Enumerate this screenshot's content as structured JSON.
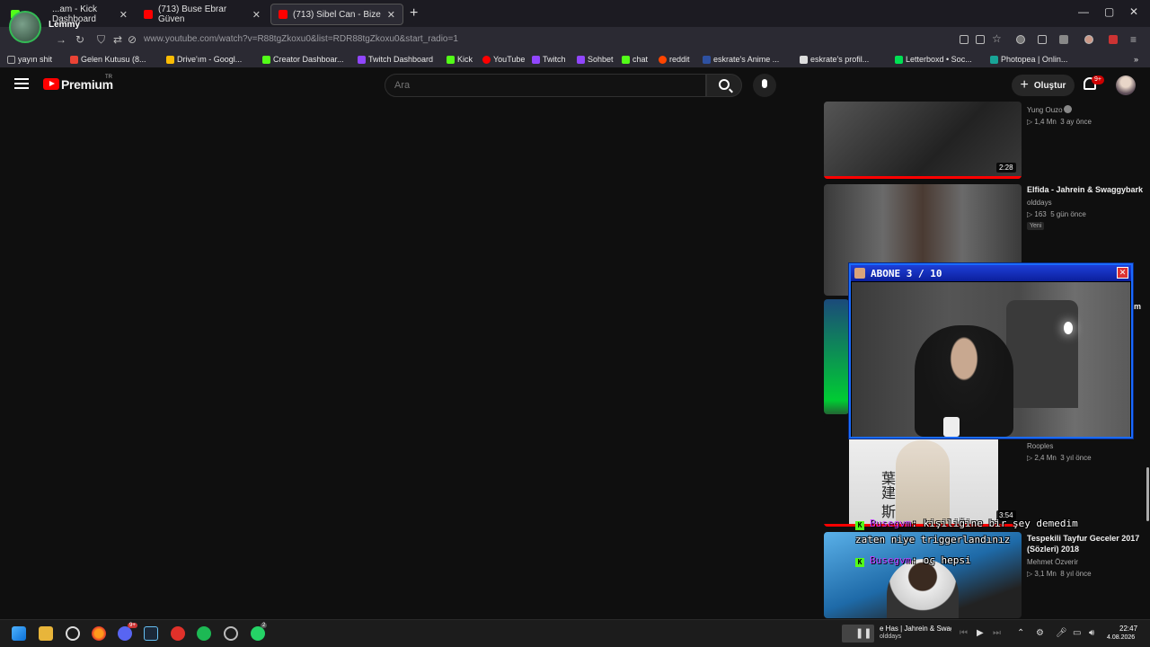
{
  "overlay": {
    "streamer_name": "Lemmy"
  },
  "browser": {
    "tabs": [
      {
        "label": "...am - Kick Dashboard",
        "favicon_color": "#53fc18"
      },
      {
        "label": "(713) Buse Ebrar Güven",
        "favicon_color": "#ff0000"
      },
      {
        "label": "(713) Sibel Can - Bize",
        "favicon_color": "#ff0000"
      }
    ],
    "url": "www.youtube.com/watch?v=R88tgZkoxu0&list=RDR88tgZkoxu0&start_radio=1",
    "bookmarks": [
      {
        "label": "yayın shit",
        "color": "#aaaaaa"
      },
      {
        "label": "Gelen Kutusu (8...",
        "color": "#ea4335"
      },
      {
        "label": "Drive'ım - Googl...",
        "color": "#fbbc04"
      },
      {
        "label": "Creator Dashboar...",
        "color": "#53fc18"
      },
      {
        "label": "Twitch Dashboard",
        "color": "#9146ff"
      },
      {
        "label": "Kick",
        "color": "#53fc18"
      },
      {
        "label": "YouTube",
        "color": "#ff0000"
      },
      {
        "label": "Twitch",
        "color": "#9146ff"
      },
      {
        "label": "Sohbet",
        "color": "#9146ff"
      },
      {
        "label": "chat",
        "color": "#53fc18"
      },
      {
        "label": "reddit",
        "color": "#ff4500"
      },
      {
        "label": "eskrate's Anime ...",
        "color": "#2e51a2"
      },
      {
        "label": "eskrate's profil...",
        "color": "#ffffff"
      },
      {
        "label": "Letterboxd • Soc...",
        "color": "#00e054"
      },
      {
        "label": "Photopea | Onlin...",
        "color": "#18a497"
      }
    ]
  },
  "youtube": {
    "logo_text": "Premium",
    "country": "TR",
    "search_placeholder": "Ara",
    "create_label": "Oluştur",
    "notification_count": "9+",
    "recommendations": [
      {
        "title": "",
        "channel": "Yung Ouzo",
        "views": "1,4 Mn",
        "age": "3 ay önce",
        "duration": "2:28",
        "badge": "",
        "thumb_color": "#3a3a3a",
        "progress": 1.0
      },
      {
        "title": "Elfida - Jahrein & Swaggybark",
        "channel": "olddays",
        "views": "163",
        "age": "5 gün önce",
        "duration": "",
        "badge": "Yeni",
        "thumb_color": "#4a4a4a",
        "progress": 0
      },
      {
        "title": "",
        "channel": "Rooples",
        "views": "2,4 Mn",
        "age": "3 yıl önce",
        "duration": "3:54",
        "badge": "",
        "thumb_color": "#dcdcdc",
        "progress": 1.0
      },
      {
        "title": "Tespekili Tayfur Geceler 2017 (Sözleri) 2018",
        "channel": "Mehmet Özverir",
        "views": "3,1 Mn",
        "age": "8 yıl önce",
        "duration": "",
        "badge": "",
        "thumb_color": "#2a7ab8",
        "progress": 0
      }
    ],
    "partial_title_fragment": "m",
    "thumb_text": "葉建 斯"
  },
  "popup": {
    "title": "ABONE 3 / 10"
  },
  "chat": [
    {
      "user": "Busegvm",
      "message": ": kişiliğine bir şey demedim"
    },
    {
      "user": "",
      "message": "zaten niye triggerlandınız"
    },
    {
      "user": "Busegvm",
      "message": ": oç hepsi"
    }
  ],
  "taskbar": {
    "media_title": "e Has | Jahrein & Swagg",
    "media_channel": "olddays",
    "discord_badge": "9+",
    "whatsapp_badge": "2",
    "time": "22:47",
    "date": "4.08.2026"
  }
}
